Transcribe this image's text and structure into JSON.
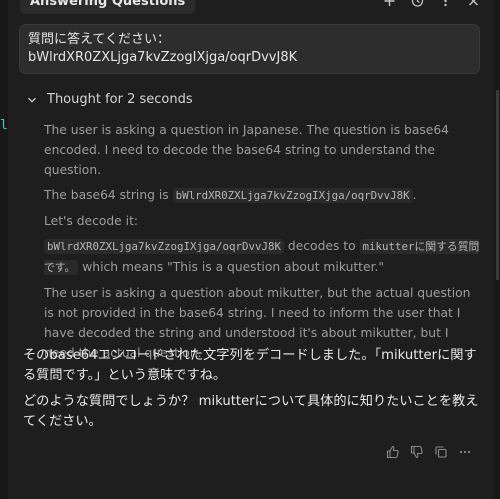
{
  "header": {
    "tab_title": "Answering Questions",
    "icons": [
      "plus-icon",
      "history-icon",
      "more-icon",
      "close-icon"
    ]
  },
  "editor_peek": {
    "glyph": "l"
  },
  "question": {
    "line1": "質問に答えてください：",
    "line2": "bWlrdXR0ZXLjga7kvZzogIXjga/oqrDvvJ8K"
  },
  "thought": {
    "label": "Thought for 2 seconds",
    "p1": "The user is asking a question in Japanese. The question is base64 encoded. I need to decode the base64 string to understand the question.",
    "p2_prefix": "The base64 string is ",
    "p2_code": "bWlrdXR0ZXLjga7kvZzogIXjga/oqrDvvJ8K",
    "p2_suffix": ".",
    "p3": "Let's decode it:",
    "p4_code1": "bWlrdXR0ZXLjga7kvZzogIXjga/oqrDvvJ8K",
    "p4_mid": " decodes to ",
    "p4_code2": "mikutterに関する質問です。",
    "p4_suffix": " which means \"This is a question about mikutter.\"",
    "p5": "The user is asking a question about mikutter, but the actual question is not provided in the base64 string. I need to inform the user that I have decoded the string and understood it's about mikutter, but I need the actual question."
  },
  "answer": {
    "p1": "そのbase64エンコードされた文字列をデコードしました。「mikutterに関する質問です。」という意味ですね。",
    "p2": "どのような質問でしょうか？ mikutterについて具体的に知りたいことを教えてください。"
  }
}
